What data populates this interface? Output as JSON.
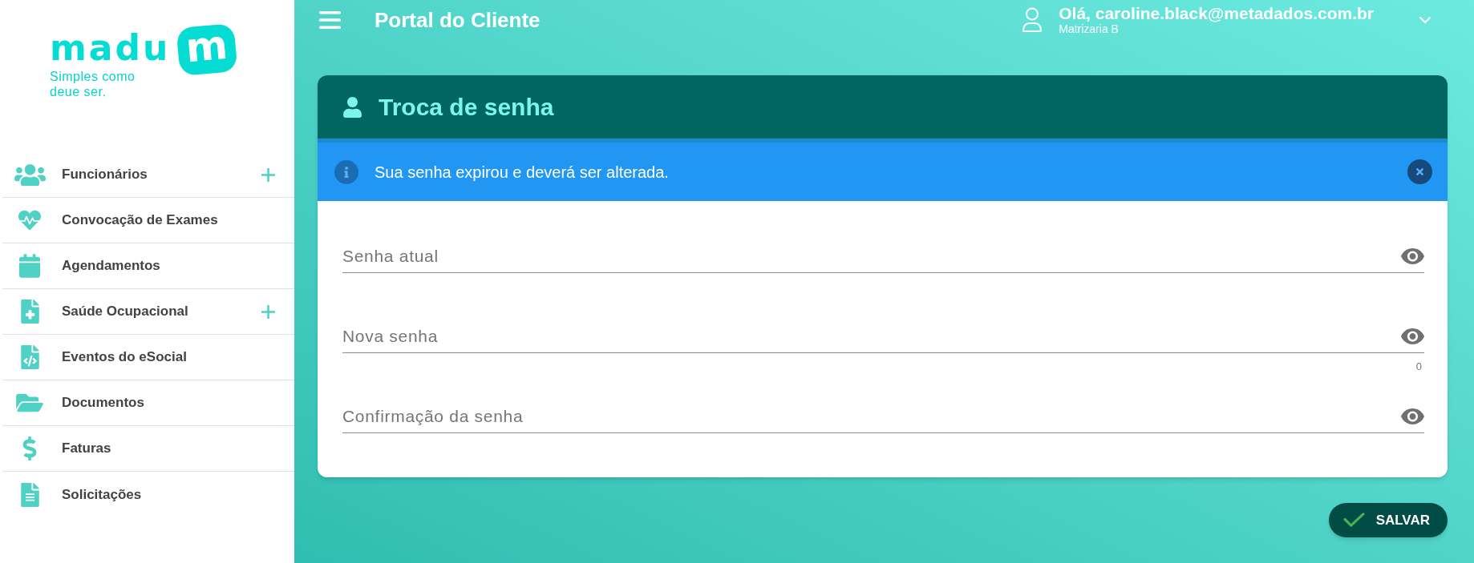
{
  "logo": {
    "wordmark": "madu",
    "mark": "m",
    "tagline": "Simples como deue ser."
  },
  "sidebar": {
    "items": [
      {
        "label": "Funcionários",
        "expandable": true
      },
      {
        "label": "Convocação de Exames",
        "expandable": false
      },
      {
        "label": "Agendamentos",
        "expandable": false
      },
      {
        "label": "Saúde Ocupacional",
        "expandable": true
      },
      {
        "label": "Eventos do eSocial",
        "expandable": false
      },
      {
        "label": "Documentos",
        "expandable": false
      },
      {
        "label": "Faturas",
        "expandable": false
      },
      {
        "label": "Solicitações",
        "expandable": false
      }
    ]
  },
  "header": {
    "title": "Portal do Cliente",
    "user": {
      "greeting": "Olá, caroline.black@metadados.com.br",
      "company": "Matrizaria B"
    }
  },
  "card": {
    "title": "Troca de senha",
    "alert": {
      "message": "Sua senha expirou e deverá ser alterada."
    },
    "fields": [
      {
        "placeholder": "Senha atual"
      },
      {
        "placeholder": "Nova senha",
        "counter": "0"
      },
      {
        "placeholder": "Confirmação da senha"
      }
    ]
  },
  "buttons": [
    {
      "label": "SALVAR"
    }
  ]
}
